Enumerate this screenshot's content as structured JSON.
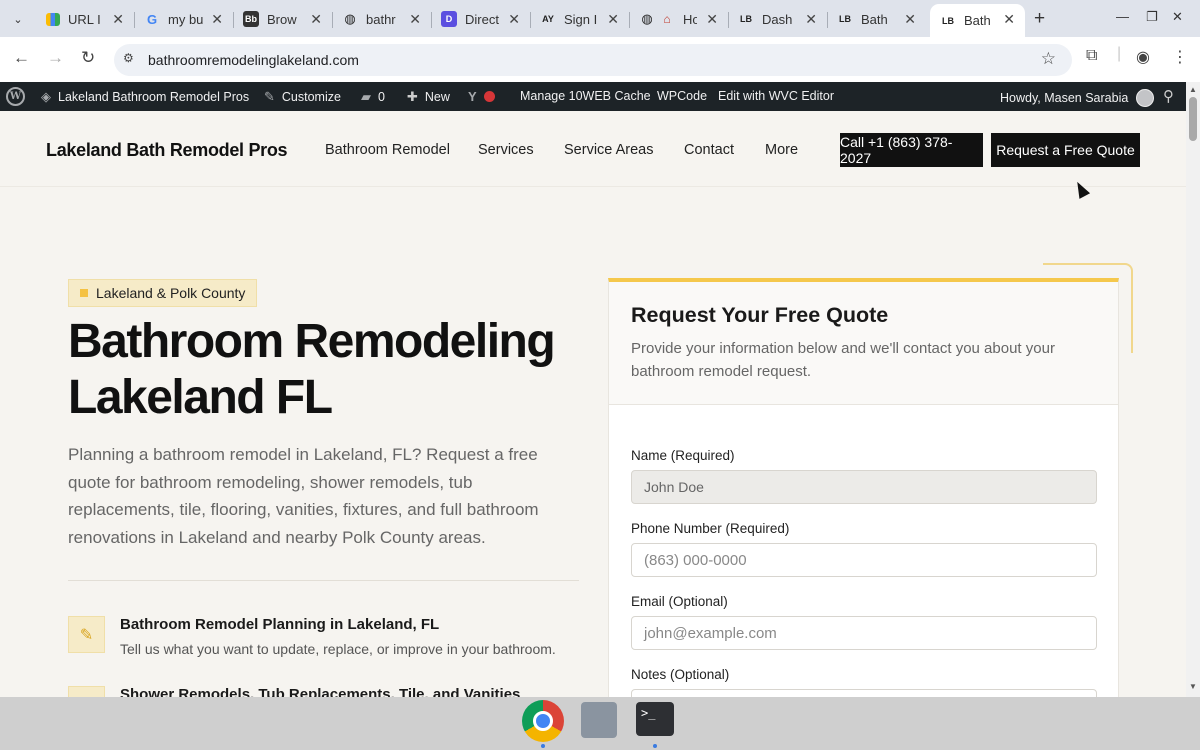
{
  "browser": {
    "tabs": [
      {
        "title": "URL I",
        "favicon": "chart-icon",
        "active": false
      },
      {
        "title": "my bu",
        "favicon": "google-icon",
        "active": false
      },
      {
        "title": "Brow",
        "favicon": "bb-icon",
        "active": false
      },
      {
        "title": "bathr",
        "favicon": "globe-icon",
        "active": false
      },
      {
        "title": "Direct",
        "favicon": "d-icon",
        "active": false
      },
      {
        "title": "Sign I",
        "favicon": "ay-icon",
        "active": false
      },
      {
        "title": "Ho",
        "favicon": "globe-home-icon",
        "active": false
      },
      {
        "title": "Dash",
        "favicon": "lb-icon",
        "active": false
      },
      {
        "title": "Bath",
        "favicon": "lb-icon",
        "active": false
      },
      {
        "title": "Bath",
        "favicon": "lb-icon",
        "active": true
      }
    ],
    "favicon_text": {
      "bb": "Bb",
      "d": "D",
      "ay": "AY",
      "lb": "LB"
    },
    "url": "bathroomremodelinglakeland.com"
  },
  "adminbar": {
    "site_name": "Lakeland Bathroom Remodel Pros",
    "customize": "Customize",
    "comments_count": "0",
    "new": "New",
    "cache": "Manage 10WEB Cache",
    "wpcode": "WPCode",
    "editor": "Edit with WVC Editor",
    "howdy": "Howdy, Masen Sarabia"
  },
  "header": {
    "brand": "Lakeland Bath Remodel Pros",
    "menu": [
      "Bathroom Remodel",
      "Services",
      "Service Areas",
      "Contact",
      "More"
    ],
    "call_button": "Call +1 (863) 378-2027",
    "quote_button": "Request a Free Quote"
  },
  "hero": {
    "badge": "Lakeland & Polk County",
    "title": "Bathroom Remodeling Lakeland FL",
    "text": "Planning a bathroom remodel in Lakeland, FL? Request a free quote for bathroom remodeling, shower remodels, tub replacements, tile, flooring, vanities, fixtures, and full bathroom renovations in Lakeland and nearby Polk County areas.",
    "features": [
      {
        "title": "Bathroom Remodel Planning in Lakeland, FL",
        "desc": "Tell us what you want to update, replace, or improve in your bathroom.",
        "icon": "ruler-icon"
      },
      {
        "title": "Shower Remodels, Tub Replacements, Tile, and Vanities",
        "desc": "",
        "icon": "tools-icon"
      }
    ]
  },
  "form": {
    "title": "Request Your Free Quote",
    "subtitle": "Provide your information below and we'll contact you about your bathroom remodel request.",
    "name_label": "Name (Required)",
    "name_value": "John Doe",
    "phone_label": "Phone Number (Required)",
    "phone_placeholder": "(863) 000-0000",
    "email_label": "Email (Optional)",
    "email_placeholder": "john@example.com",
    "notes_label": "Notes (Optional)"
  },
  "colors": {
    "accent": "#f5c84c",
    "dark": "#111111",
    "page_bg": "#f6f4f0",
    "adminbar": "#1d2327"
  }
}
